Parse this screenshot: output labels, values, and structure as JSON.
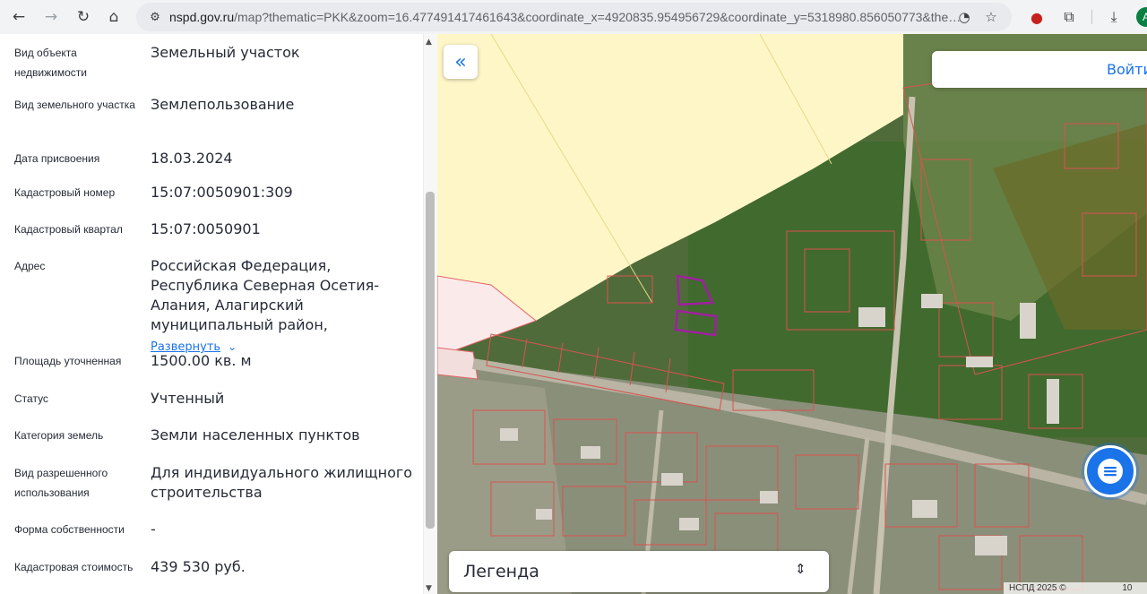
{
  "browser": {
    "url_host": "nspd.gov.ru",
    "url_rest": "/map?thematic=PKK&zoom=16.477491417461643&coordinate_x=4920835.954956729&coordinate_y=5318980.856050773&the…",
    "avatar_letter": "A"
  },
  "fields": [
    {
      "label": "Вид объекта недвижимости",
      "value": "Земельный участок"
    },
    {
      "label": "Вид земельного участка",
      "value": "Землепользование"
    },
    {
      "label": "Дата присвоения",
      "value": "18.03.2024"
    },
    {
      "label": "Кадастровый номер",
      "value": "15:07:0050901:309"
    },
    {
      "label": "Кадастровый квартал",
      "value": "15:07:0050901"
    },
    {
      "label": "Адрес",
      "value": "Российская Федерация, Республика Северная Осетия-Алания, Алагирский муниципальный район,",
      "expand": "Развернуть"
    },
    {
      "label": "Площадь уточненная",
      "value": "1500.00 кв. м"
    },
    {
      "label": "Статус",
      "value": "Учтенный"
    },
    {
      "label": "Категория земель",
      "value": "Земли населенных пунктов"
    },
    {
      "label": "Вид разрешенного использования",
      "value": "Для индивидуального жилищного строительства"
    },
    {
      "label": "Форма собственности",
      "value": "-"
    },
    {
      "label": "Кадастровая стоимость",
      "value": "439 530 руб."
    }
  ],
  "map": {
    "login_label": "Войти",
    "legend_label": "Легенда",
    "attribution": "НСПД 2025 ©",
    "scale_fragment": "10"
  },
  "colors": {
    "accent": "#1a73e8",
    "parcel_border": "#d9534f",
    "selected_parcel": "#a020a0",
    "zone_fill": "#fff6c8"
  }
}
